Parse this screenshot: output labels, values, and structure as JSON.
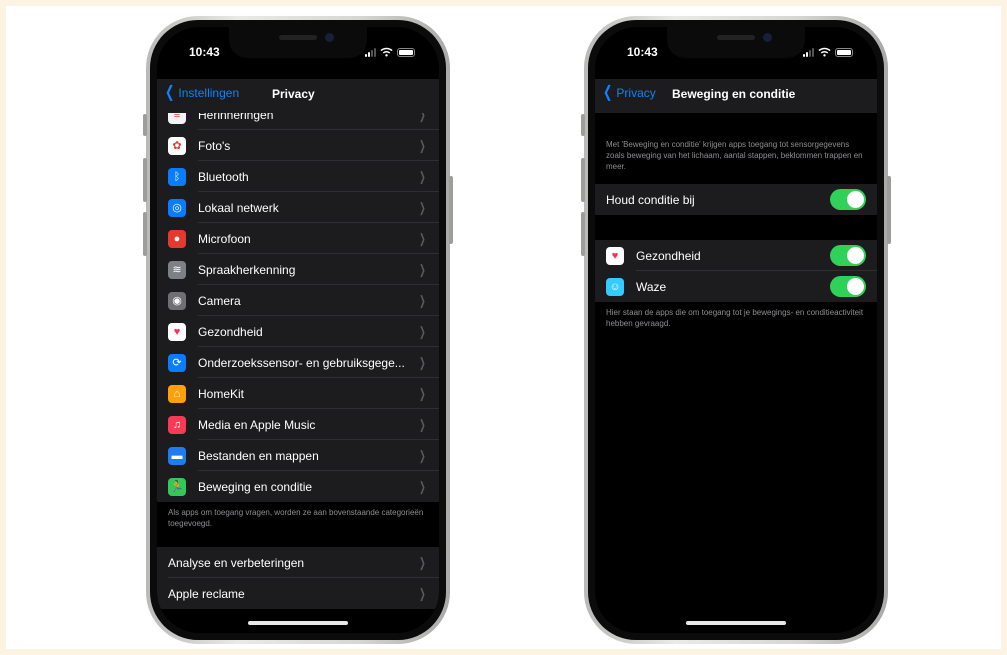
{
  "colors": {
    "accent": "#0a84ff",
    "toggle_on": "#30d158",
    "background": "#fdf3e3"
  },
  "phone_left": {
    "status": {
      "time": "10:43"
    },
    "nav": {
      "back": "Instellingen",
      "title": "Privacy"
    },
    "list": [
      {
        "label": "Herinneringen",
        "icon": "reminders-icon",
        "color": "#f2f2f7",
        "glyph": "≡"
      },
      {
        "label": "Foto's",
        "icon": "photos-icon",
        "color": "#ffffff",
        "glyph": "✿"
      },
      {
        "label": "Bluetooth",
        "icon": "bluetooth-icon",
        "color": "#0a7cff",
        "glyph": "ᛒ"
      },
      {
        "label": "Lokaal netwerk",
        "icon": "local-network-icon",
        "color": "#0a7cff",
        "glyph": "◎"
      },
      {
        "label": "Microfoon",
        "icon": "microphone-icon",
        "color": "#e5392f",
        "glyph": "●"
      },
      {
        "label": "Spraakherkenning",
        "icon": "speech-recognition-icon",
        "color": "#7f7f86",
        "glyph": "≋"
      },
      {
        "label": "Camera",
        "icon": "camera-icon",
        "color": "#6f6f74",
        "glyph": "◉"
      },
      {
        "label": "Gezondheid",
        "icon": "health-icon",
        "color": "#ffffff",
        "glyph": "♥"
      },
      {
        "label": "Onderzoekssensor- en gebruiksgege...",
        "icon": "research-sensor-icon",
        "color": "#0a7cff",
        "glyph": "⟳"
      },
      {
        "label": "HomeKit",
        "icon": "homekit-icon",
        "color": "#ff9f0a",
        "glyph": "⌂"
      },
      {
        "label": "Media en Apple Music",
        "icon": "music-icon",
        "color": "#fa3a55",
        "glyph": "♫"
      },
      {
        "label": "Bestanden en mappen",
        "icon": "files-icon",
        "color": "#1e7cf0",
        "glyph": "▬"
      },
      {
        "label": "Beweging en conditie",
        "icon": "motion-fitness-icon",
        "color": "#34c759",
        "glyph": "🏃"
      }
    ],
    "footnote": "Als apps om toegang vragen, worden ze aan bovenstaande categorieën toegevoegd.",
    "list2": [
      {
        "label": "Analyse en verbeteringen"
      },
      {
        "label": "Apple reclame"
      }
    ]
  },
  "phone_right": {
    "status": {
      "time": "10:43"
    },
    "nav": {
      "back": "Privacy",
      "title": "Beweging en conditie"
    },
    "description": "Met 'Beweging en conditie' krijgen apps toegang tot sensorgegevens zoals beweging van het lichaam, aantal stappen, beklommen trappen en meer.",
    "fitness_tracking": {
      "label": "Houd conditie bij",
      "on": true
    },
    "apps": [
      {
        "label": "Gezondheid",
        "icon": "health-icon",
        "color": "#ffffff",
        "glyph": "♥",
        "on": true
      },
      {
        "label": "Waze",
        "icon": "waze-icon",
        "color": "#33ccff",
        "glyph": "☺",
        "on": true
      }
    ],
    "footnote": "Hier staan de apps die om toegang tot je bewegings- en conditieactiviteit hebben gevraagd."
  }
}
